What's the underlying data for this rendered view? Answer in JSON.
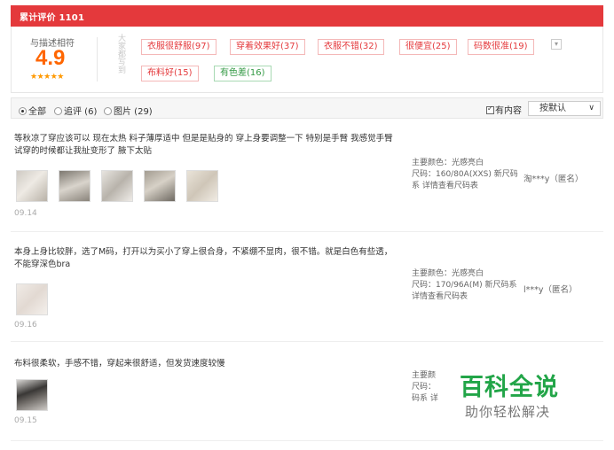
{
  "header": {
    "title": "累计评价 1101"
  },
  "summary": {
    "score_label": "与描述相符",
    "score": "4.9",
    "stars": "★★★★★",
    "vertical_label": "大家都写到",
    "tags": [
      {
        "label": "衣服很舒服(97)",
        "type": "red"
      },
      {
        "label": "穿着效果好(37)",
        "type": "red"
      },
      {
        "label": "衣服不错(32)",
        "type": "red"
      },
      {
        "label": "很便宜(25)",
        "type": "red"
      },
      {
        "label": "码数很准(19)",
        "type": "red"
      },
      {
        "label": "布料好(15)",
        "type": "red"
      },
      {
        "label": "有色差(16)",
        "type": "green"
      }
    ],
    "expand_icon": "chevron-down-icon"
  },
  "filters": {
    "all": "全部",
    "followup": "追评 (6)",
    "pictures": "图片 (29)",
    "has_content": "有内容",
    "sort_selected": "按默认"
  },
  "reviews": [
    {
      "text": "等秋凉了穿应该可以 现在太热 料子薄厚适中 但是是贴身的 穿上身要调整一下 特别是手臂 我感觉手臂试穿的时候都让我扯变形了 腋下太贴",
      "date": "09.14",
      "color_line": "主要颜色：光感亮白",
      "size_line": "尺码：160/80A(XXS) 新尺码系 详情查看尺码表",
      "user": "淘***y（匿名）",
      "thumb_count": 5
    },
    {
      "text": "本身上身比较胖，选了M码，打开以为买小了穿上很合身，不紧绷不显肉，很不错。就是白色有些透，不能穿深色bra",
      "date": "09.16",
      "color_line": "主要颜色：光感亮白",
      "size_line": "尺码：170/96A(M) 新尺码系 详情查看尺码表",
      "user": "l***y（匿名）",
      "thumb_count": 1
    },
    {
      "text": "布料很柔软，手感不错，穿起来很舒适，但发货速度较慢",
      "date": "09.15",
      "color_line": "主要颜",
      "size_line": "尺码：",
      "size_line2": "码系 详",
      "user": "",
      "thumb_count": 1
    }
  ],
  "watermark": {
    "big": "百科全说",
    "small": "助你轻松解决"
  }
}
